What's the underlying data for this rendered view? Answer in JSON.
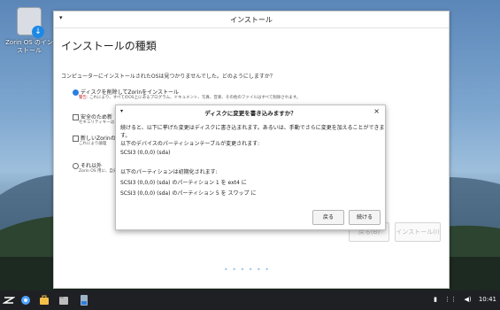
{
  "desktop": {
    "icon_label": "Zorin OS のインストール"
  },
  "installer": {
    "menu_glyph": "▾",
    "window_title": "インストール",
    "heading": "インストールの種類",
    "question": "コンピューターにインストールされたOSは見つかりませんでした。どのようにしますか？",
    "options": [
      {
        "label": "ディスクを削除してZorinをインストール",
        "sub_warn": "警告:",
        "sub": " これにより、すべてのOS上にあるプログラム、ドキュメント、写真、音楽、その他のファイルはすべて削除されます。"
      },
      {
        "label": "安全のため新",
        "sub": "セキュリティキーは"
      },
      {
        "label": "新しいZorinの",
        "sub": "これにより論理"
      },
      {
        "label": "それ以外",
        "sub": "Zorin OS 用に、自分"
      }
    ],
    "buttons": {
      "back": "戻る(B)",
      "install": "インストール(I)"
    },
    "progress_dots": "• • • • • •"
  },
  "dialog": {
    "menu_glyph": "▾",
    "title": "ディスクに変更を書き込みますか？",
    "close": "×",
    "message": "続けると、以下に挙げた変更はディスクに書き込まれます。あるいは、手動でさらに変更を加えることができます。",
    "partition_table_heading": "以下のデバイスのパーティションテーブルが変更されます:",
    "partition_table_devices": [
      "SCSI3 (0,0,0) (sda)"
    ],
    "format_heading": "以下のパーティションは初期化されます:",
    "format_items": [
      "SCSI3 (0,0,0) (sda) のパーティション 1 を ext4 に",
      "SCSI3 (0,0,0) (sda) のパーティション 5 を スワップ に"
    ],
    "back_button": "戻る",
    "continue_button": "続ける"
  },
  "taskbar": {
    "clock": "10:41"
  }
}
